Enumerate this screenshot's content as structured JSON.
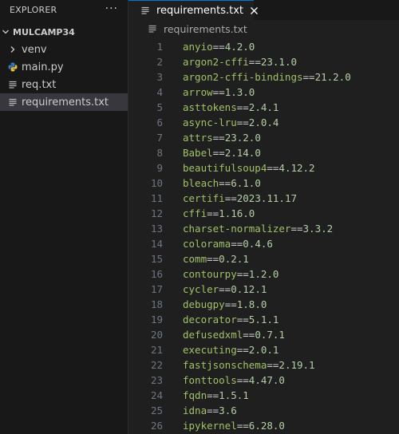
{
  "explorer": {
    "title": "EXPLORER",
    "more": "···",
    "folder": "MULCAMP34",
    "items": [
      {
        "label": "venv",
        "type": "folder"
      },
      {
        "label": "main.py",
        "type": "python"
      },
      {
        "label": "req.txt",
        "type": "text"
      },
      {
        "label": "requirements.txt",
        "type": "text",
        "selected": true
      }
    ]
  },
  "editor": {
    "tab": {
      "label": "requirements.txt"
    },
    "breadcrumb": "requirements.txt",
    "lines": [
      {
        "n": "1",
        "pkg": "anyio",
        "ver": "4.2.0"
      },
      {
        "n": "2",
        "pkg": "argon2-cffi",
        "ver": "23.1.0"
      },
      {
        "n": "3",
        "pkg": "argon2-cffi-bindings",
        "ver": "21.2.0"
      },
      {
        "n": "4",
        "pkg": "arrow",
        "ver": "1.3.0"
      },
      {
        "n": "5",
        "pkg": "asttokens",
        "ver": "2.4.1"
      },
      {
        "n": "6",
        "pkg": "async-lru",
        "ver": "2.0.4"
      },
      {
        "n": "7",
        "pkg": "attrs",
        "ver": "23.2.0"
      },
      {
        "n": "8",
        "pkg": "Babel",
        "ver": "2.14.0"
      },
      {
        "n": "9",
        "pkg": "beautifulsoup4",
        "ver": "4.12.2"
      },
      {
        "n": "10",
        "pkg": "bleach",
        "ver": "6.1.0"
      },
      {
        "n": "11",
        "pkg": "certifi",
        "ver": "2023.11.17"
      },
      {
        "n": "12",
        "pkg": "cffi",
        "ver": "1.16.0"
      },
      {
        "n": "13",
        "pkg": "charset-normalizer",
        "ver": "3.3.2"
      },
      {
        "n": "14",
        "pkg": "colorama",
        "ver": "0.4.6"
      },
      {
        "n": "15",
        "pkg": "comm",
        "ver": "0.2.1"
      },
      {
        "n": "16",
        "pkg": "contourpy",
        "ver": "1.2.0"
      },
      {
        "n": "17",
        "pkg": "cycler",
        "ver": "0.12.1"
      },
      {
        "n": "18",
        "pkg": "debugpy",
        "ver": "1.8.0"
      },
      {
        "n": "19",
        "pkg": "decorator",
        "ver": "5.1.1"
      },
      {
        "n": "20",
        "pkg": "defusedxml",
        "ver": "0.7.1"
      },
      {
        "n": "21",
        "pkg": "executing",
        "ver": "2.0.1"
      },
      {
        "n": "22",
        "pkg": "fastjsonschema",
        "ver": "2.19.1"
      },
      {
        "n": "23",
        "pkg": "fonttools",
        "ver": "4.47.0"
      },
      {
        "n": "24",
        "pkg": "fqdn",
        "ver": "1.5.1"
      },
      {
        "n": "25",
        "pkg": "idna",
        "ver": "3.6"
      },
      {
        "n": "26",
        "pkg": "ipykernel",
        "ver": "6.28.0"
      }
    ],
    "operator": "=="
  },
  "colors": {
    "accent": "#0078d4",
    "package": "#a1c06a",
    "version": "#b5cea8",
    "lineNumber": "#6e7681"
  }
}
